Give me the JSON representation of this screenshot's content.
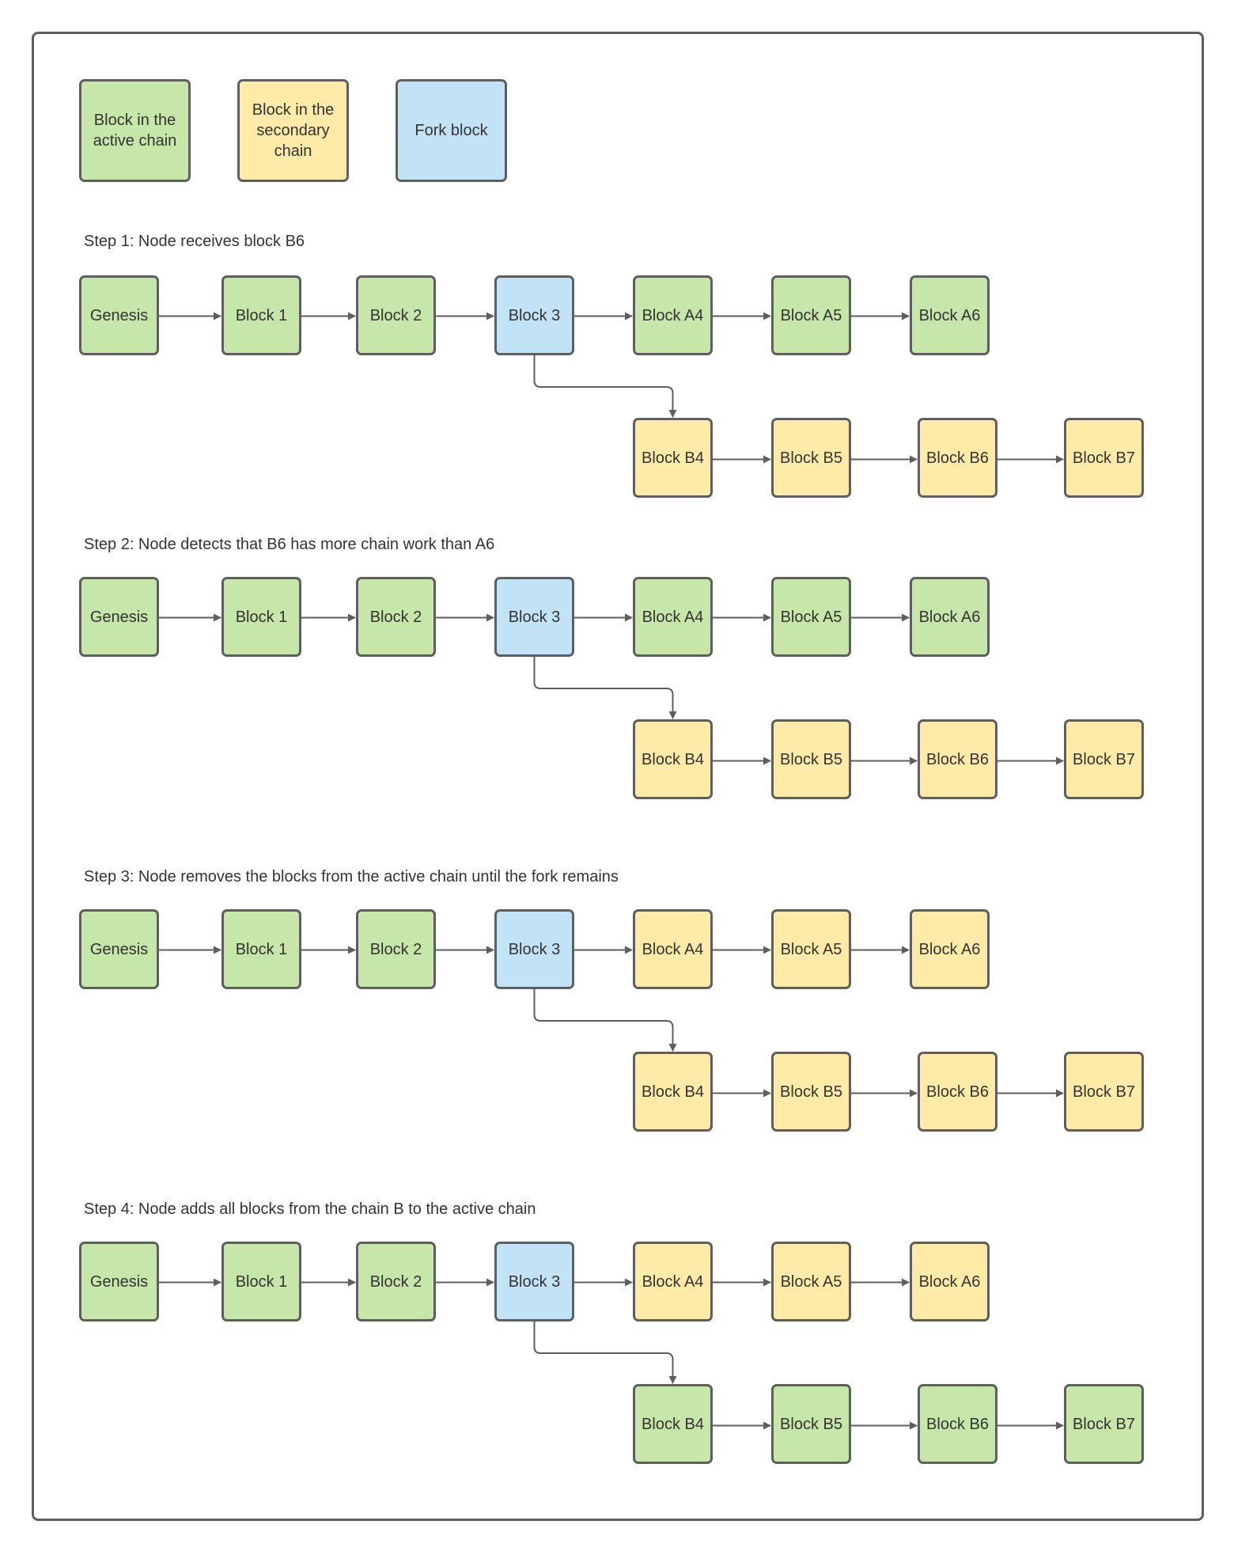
{
  "colors": {
    "active": "#c7e6a9",
    "secondary": "#ffeaa7",
    "fork": "#c2e3f6",
    "border": "#5e5e5e",
    "connector": "#5e5e5e"
  },
  "legend": [
    {
      "label": "Block in the active chain",
      "state": "active"
    },
    {
      "label": "Block in the secondary chain",
      "state": "secondary"
    },
    {
      "label": "Fork block",
      "state": "fork"
    }
  ],
  "steps": [
    {
      "label": "Step 1: Node receives block B6",
      "main_chain": [
        {
          "label": "Genesis",
          "state": "active"
        },
        {
          "label": "Block 1",
          "state": "active"
        },
        {
          "label": "Block 2",
          "state": "active"
        },
        {
          "label": "Block 3",
          "state": "fork"
        },
        {
          "label": "Block A4",
          "state": "active"
        },
        {
          "label": "Block A5",
          "state": "active"
        },
        {
          "label": "Block A6",
          "state": "active"
        }
      ],
      "branch_chain": [
        {
          "label": "Block B4",
          "state": "secondary"
        },
        {
          "label": "Block B5",
          "state": "secondary"
        },
        {
          "label": "Block B6",
          "state": "secondary"
        },
        {
          "label": "Block B7",
          "state": "secondary"
        }
      ]
    },
    {
      "label": "Step 2: Node detects that B6 has more chain work than A6",
      "main_chain": [
        {
          "label": "Genesis",
          "state": "active"
        },
        {
          "label": "Block 1",
          "state": "active"
        },
        {
          "label": "Block 2",
          "state": "active"
        },
        {
          "label": "Block 3",
          "state": "fork"
        },
        {
          "label": "Block A4",
          "state": "active"
        },
        {
          "label": "Block A5",
          "state": "active"
        },
        {
          "label": "Block A6",
          "state": "active"
        }
      ],
      "branch_chain": [
        {
          "label": "Block B4",
          "state": "secondary"
        },
        {
          "label": "Block B5",
          "state": "secondary"
        },
        {
          "label": "Block B6",
          "state": "secondary"
        },
        {
          "label": "Block B7",
          "state": "secondary"
        }
      ]
    },
    {
      "label": "Step 3: Node removes the blocks from the active chain until the fork remains",
      "main_chain": [
        {
          "label": "Genesis",
          "state": "active"
        },
        {
          "label": "Block 1",
          "state": "active"
        },
        {
          "label": "Block 2",
          "state": "active"
        },
        {
          "label": "Block 3",
          "state": "fork"
        },
        {
          "label": "Block A4",
          "state": "secondary"
        },
        {
          "label": "Block A5",
          "state": "secondary"
        },
        {
          "label": "Block A6",
          "state": "secondary"
        }
      ],
      "branch_chain": [
        {
          "label": "Block B4",
          "state": "secondary"
        },
        {
          "label": "Block B5",
          "state": "secondary"
        },
        {
          "label": "Block B6",
          "state": "secondary"
        },
        {
          "label": "Block B7",
          "state": "secondary"
        }
      ]
    },
    {
      "label": "Step 4: Node adds all blocks from the chain B to the active chain",
      "main_chain": [
        {
          "label": "Genesis",
          "state": "active"
        },
        {
          "label": "Block 1",
          "state": "active"
        },
        {
          "label": "Block 2",
          "state": "active"
        },
        {
          "label": "Block 3",
          "state": "fork"
        },
        {
          "label": "Block A4",
          "state": "secondary"
        },
        {
          "label": "Block A5",
          "state": "secondary"
        },
        {
          "label": "Block A6",
          "state": "secondary"
        }
      ],
      "branch_chain": [
        {
          "label": "Block B4",
          "state": "active"
        },
        {
          "label": "Block B5",
          "state": "active"
        },
        {
          "label": "Block B6",
          "state": "active"
        },
        {
          "label": "Block B7",
          "state": "active"
        }
      ]
    }
  ]
}
